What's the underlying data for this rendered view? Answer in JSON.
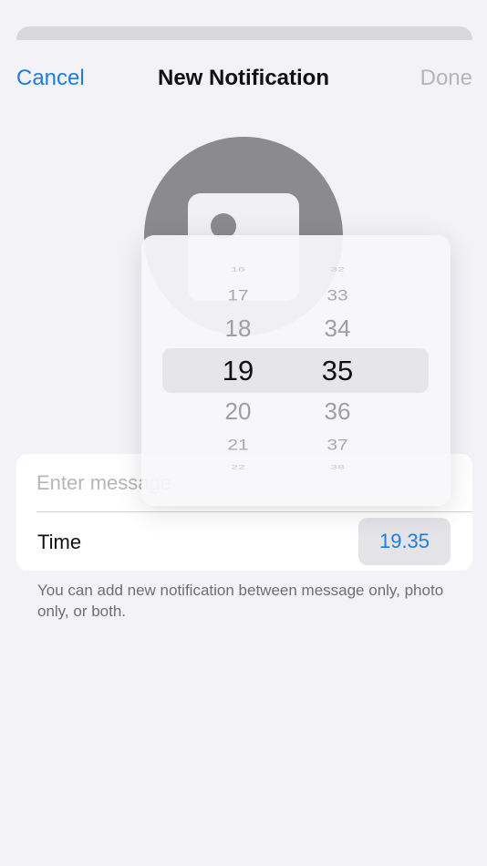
{
  "nav": {
    "cancel": "Cancel",
    "title": "New Notification",
    "done": "Done"
  },
  "form": {
    "message_placeholder": "Enter message",
    "time_label": "Time",
    "time_value": "19.35"
  },
  "hint": "You can add new notification between message only, photo only, or both.",
  "picker": {
    "hours": [
      "16",
      "17",
      "18",
      "19",
      "20",
      "21",
      "22"
    ],
    "minutes": [
      "32",
      "33",
      "34",
      "35",
      "36",
      "37",
      "38"
    ]
  },
  "colors": {
    "accent": "#1c7ee0",
    "background": "#f2f2f7",
    "disabled": "#b5b5ba"
  }
}
